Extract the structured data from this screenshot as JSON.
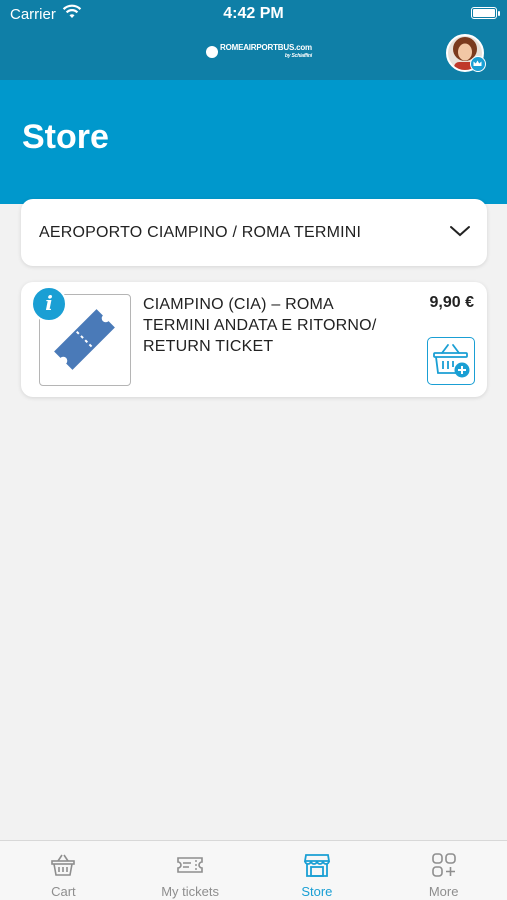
{
  "status_bar": {
    "carrier": "Carrier",
    "time": "4:42 PM"
  },
  "header": {
    "logo_text": "ROMEAIRPORTBUS.com",
    "logo_sub": "by Schiaffini"
  },
  "page": {
    "title": "Store"
  },
  "route_selector": {
    "selected": "AEROPORTO CIAMPINO / ROMA TERMINI"
  },
  "products": [
    {
      "title": "CIAMPINO (CIA) – ROMA TERMINI ANDATA E RITORNO/ RETURN TICKET",
      "price": "9,90 €",
      "info_glyph": "i"
    }
  ],
  "tabs": [
    {
      "label": "Cart",
      "icon": "basket-icon",
      "active": false
    },
    {
      "label": "My tickets",
      "icon": "ticket-icon",
      "active": false
    },
    {
      "label": "Store",
      "icon": "store-icon",
      "active": true
    },
    {
      "label": "More",
      "icon": "more-grid-icon",
      "active": false
    }
  ],
  "colors": {
    "header": "#0f7fa7",
    "hero": "#0098cc",
    "accent": "#1a9fd4",
    "ticket": "#4a7ab8"
  }
}
